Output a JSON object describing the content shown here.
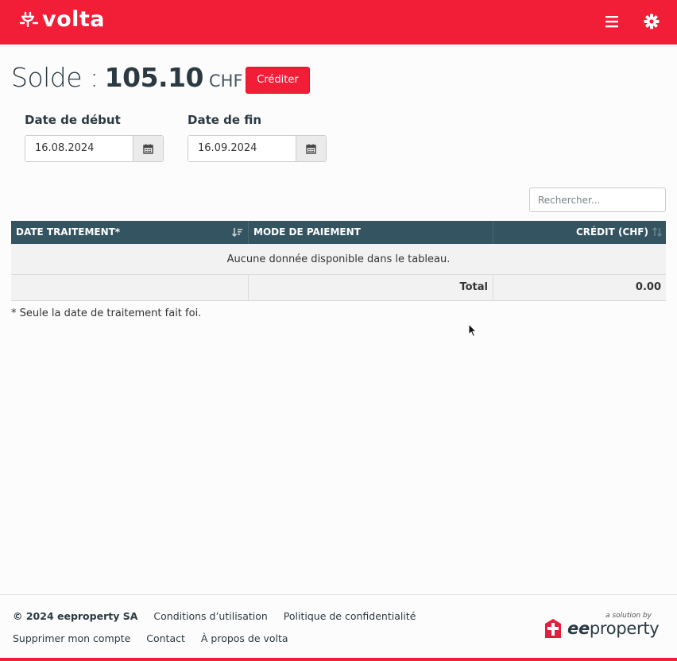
{
  "header": {
    "logo_text": "volta",
    "brand_color": "#f21d36",
    "menu_icon": "hamburger-menu-icon",
    "settings_icon": "gear-icon"
  },
  "balance": {
    "label": "Solde :",
    "amount": "105.10",
    "currency": "CHF",
    "credit_button": "Créditer"
  },
  "filters": {
    "start_label": "Date de début",
    "start_value": "16.08.2024",
    "end_label": "Date de fin",
    "end_value": "16.09.2024",
    "calendar_icon": "calendar-icon"
  },
  "search": {
    "placeholder": "Rechercher..."
  },
  "table": {
    "columns": [
      "DATE TRAITEMENT*",
      "MODE DE PAIEMENT",
      "CRÉDIT (CHF)"
    ],
    "empty_message": "Aucune donnée disponible dans le tableau.",
    "total_label": "Total",
    "total_value": "0.00"
  },
  "note": "* Seule la date de traitement fait foi.",
  "footer": {
    "copyright": "© 2024 eeproperty SA",
    "links_row1": [
      "Conditions d’utilisation",
      "Politique de confidentialité"
    ],
    "links_row2": [
      "Supprimer mon compte",
      "Contact",
      "À propos de volta"
    ],
    "brand_tagline": "a solution by",
    "brand_name_bold": "ee",
    "brand_name_rest": "property"
  }
}
